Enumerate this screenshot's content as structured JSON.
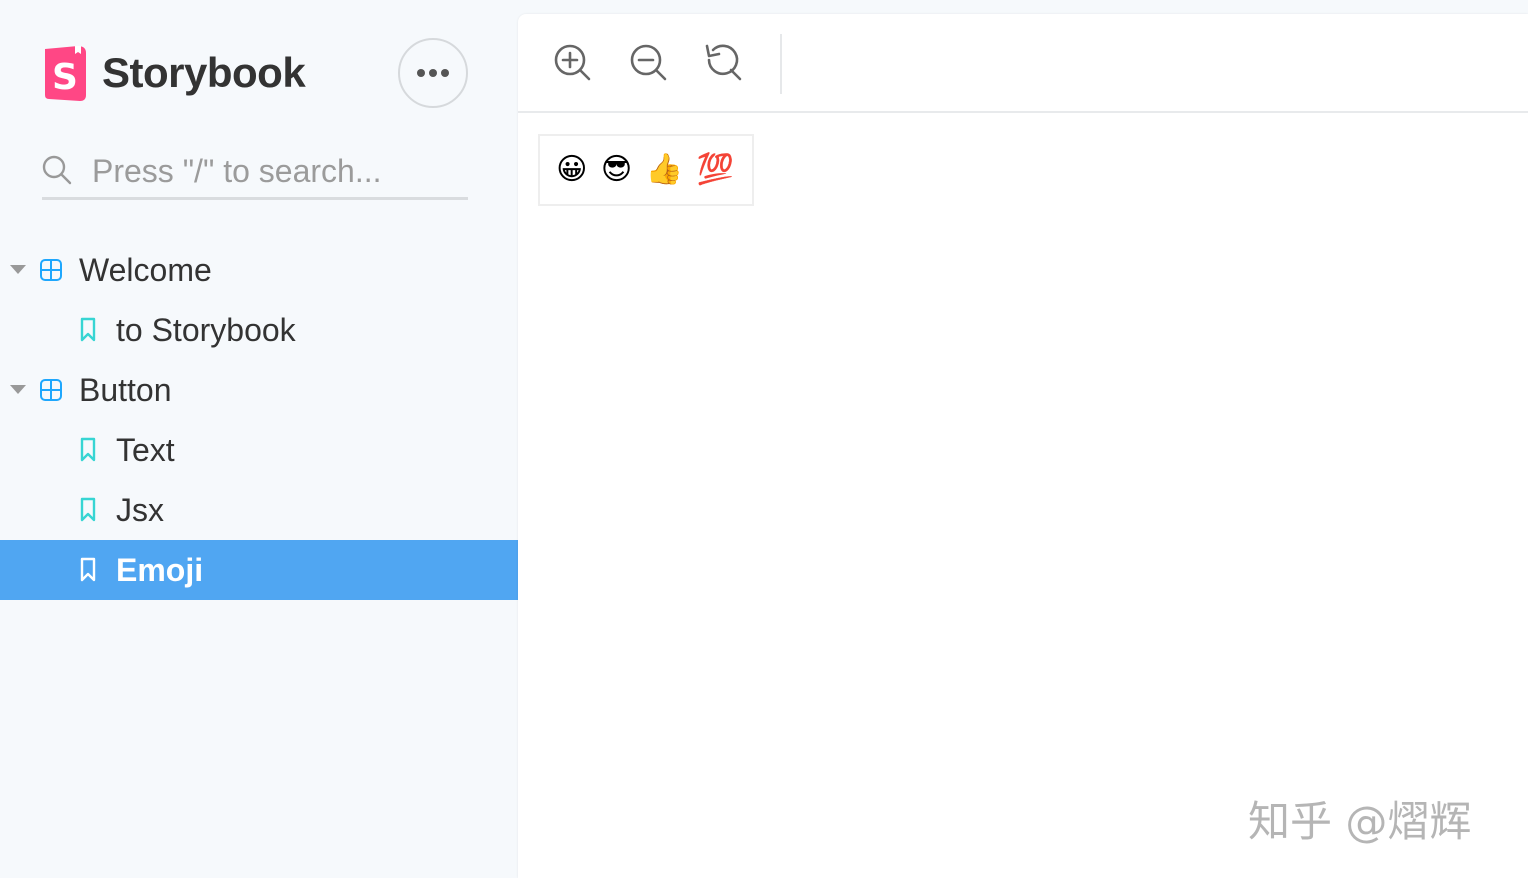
{
  "brand": {
    "name": "Storybook",
    "accent": "#ff4785"
  },
  "search": {
    "placeholder": "Press \"/\" to search..."
  },
  "menu": {
    "icon": "ellipsis-icon"
  },
  "tree": {
    "groups": [
      {
        "label": "Welcome",
        "icon": "component-icon",
        "expanded": true,
        "stories": [
          {
            "label": "to Storybook",
            "icon": "bookmark-icon",
            "selected": false
          }
        ]
      },
      {
        "label": "Button",
        "icon": "component-icon",
        "expanded": true,
        "stories": [
          {
            "label": "Text",
            "icon": "bookmark-icon",
            "selected": false
          },
          {
            "label": "Jsx",
            "icon": "bookmark-icon",
            "selected": false
          },
          {
            "label": "Emoji",
            "icon": "bookmark-icon",
            "selected": true
          }
        ]
      }
    ]
  },
  "toolbar": {
    "zoom_in": "zoom-in-icon",
    "zoom_out": "zoom-out-icon",
    "zoom_reset": "reset-zoom-icon"
  },
  "preview": {
    "button_label": "😀 😎 👍 💯"
  },
  "watermark": "知乎 @熠辉",
  "colors": {
    "selected_row": "#50a6f2",
    "component_icon": "#1ea7fd",
    "story_icon": "#37d5d3",
    "sidebar_bg": "#f6f9fc"
  }
}
